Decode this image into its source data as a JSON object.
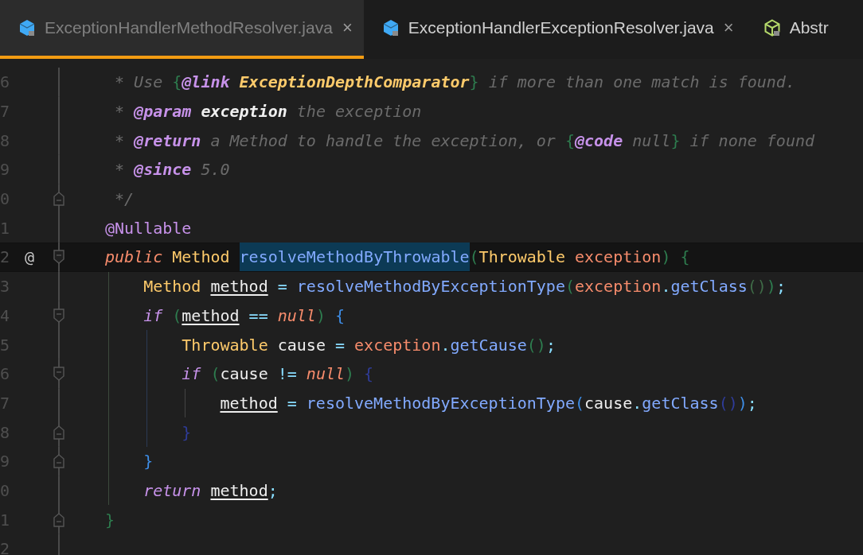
{
  "tabs": [
    {
      "label": "ExceptionHandlerMethodResolver.java",
      "close": "×",
      "selected": true
    },
    {
      "label": "ExceptionHandlerExceptionResolver.java",
      "close": "×",
      "selected": false
    },
    {
      "label": "Abstr",
      "selected": false
    }
  ],
  "editor": {
    "lines": [
      {
        "number": "6",
        "tokens": [
          {
            "kind": "comment",
            "text": "* Use"
          },
          {
            "kind": "bracket",
            "text": "{",
            "color": "#2e7d4f",
            "space_before": true
          },
          {
            "kind": "tag",
            "text": "@link"
          },
          {
            "kind": "ref",
            "text": "ExceptionDepthComparator",
            "space_before": true
          },
          {
            "kind": "bracket",
            "text": "}",
            "color": "#2e7d4f"
          },
          {
            "kind": "comment",
            "text": "if more than one match is found.",
            "space_before": true
          }
        ]
      },
      {
        "number": "7",
        "tokens": [
          {
            "kind": "comment",
            "text": "*"
          },
          {
            "kind": "tag",
            "text": "@param",
            "space_before": true
          },
          {
            "kind": "docparam",
            "text": "exception",
            "space_before": true
          },
          {
            "kind": "comment",
            "text": "the exception",
            "space_before": true
          }
        ]
      },
      {
        "number": "8",
        "tokens": [
          {
            "kind": "comment",
            "text": "*"
          },
          {
            "kind": "tag",
            "text": "@return",
            "space_before": true
          },
          {
            "kind": "comment",
            "text": "a Method to handle the exception, or",
            "space_before": true
          },
          {
            "kind": "bracket",
            "text": "{",
            "color": "#2e7d4f",
            "space_before": true
          },
          {
            "kind": "tag",
            "text": "@code"
          },
          {
            "kind": "comment",
            "text": "null",
            "space_before": true
          },
          {
            "kind": "bracket",
            "text": "}",
            "color": "#2e7d4f"
          },
          {
            "kind": "comment",
            "text": "if none found",
            "space_before": true
          }
        ]
      },
      {
        "number": "9",
        "tokens": [
          {
            "kind": "comment",
            "text": "*"
          },
          {
            "kind": "tag",
            "text": "@since",
            "space_before": true
          },
          {
            "kind": "comment",
            "text": "5.0",
            "space_before": true
          }
        ]
      },
      {
        "number": "0",
        "fold_end": true,
        "tokens": [
          {
            "kind": "comment",
            "text": "*/"
          }
        ]
      },
      {
        "number": "1",
        "tokens": [
          {
            "kind": "annotation",
            "text": "@Nullable"
          }
        ]
      },
      {
        "number": "2",
        "current": true,
        "marker": "@",
        "fold_start": true,
        "tokens": [
          {
            "kind": "modifier",
            "text": "public"
          },
          {
            "kind": "type",
            "text": "Method",
            "space_before": true
          },
          {
            "kind": "method",
            "text": "resolveMethodByThrowable",
            "highlighted": true,
            "space_before": true
          },
          {
            "kind": "bracket",
            "text": "(",
            "color": "#2e7d4f"
          },
          {
            "kind": "type",
            "text": "Throwable"
          },
          {
            "kind": "param",
            "text": "exception",
            "space_before": true
          },
          {
            "kind": "bracket",
            "text": ")",
            "color": "#2e7d4f"
          },
          {
            "kind": "bracket",
            "text": "{",
            "color": "#2e7d4f",
            "space_before": true
          }
        ],
        "children": [
          {
            "number": "3",
            "tokens": [
              {
                "kind": "type",
                "text": "Method"
              },
              {
                "kind": "reassigned",
                "text": "method",
                "space_before": true
              },
              {
                "kind": "plain",
                "text": "=",
                "space_before": true
              },
              {
                "kind": "method",
                "text": "resolveMethodByExceptionType",
                "space_before": true
              },
              {
                "kind": "bracket",
                "text": "(",
                "color": "#2e7d4f"
              },
              {
                "kind": "param",
                "text": "exception"
              },
              {
                "kind": "plain",
                "text": "."
              },
              {
                "kind": "method",
                "text": "getClass"
              },
              {
                "kind": "bracket",
                "text": "()",
                "color": "#3f6b47"
              },
              {
                "kind": "bracket",
                "text": ")",
                "color": "#2e7d4f"
              },
              {
                "kind": "plain",
                "text": ";"
              }
            ]
          },
          {
            "number": "4",
            "fold_start": true,
            "tokens": [
              {
                "kind": "control",
                "text": "if"
              },
              {
                "kind": "bracket",
                "text": "(",
                "color": "#2e7d4f",
                "space_before": true
              },
              {
                "kind": "reassigned",
                "text": "method"
              },
              {
                "kind": "plain",
                "text": "==",
                "space_before": true
              },
              {
                "kind": "literal",
                "text": "null",
                "space_before": true
              },
              {
                "kind": "bracket",
                "text": ")",
                "color": "#2e7d4f"
              },
              {
                "kind": "bracket",
                "text": "{",
                "color": "#3e8ee8",
                "space_before": true
              }
            ],
            "children": [
              {
                "number": "5",
                "tokens": [
                  {
                    "kind": "type",
                    "text": "Throwable"
                  },
                  {
                    "kind": "var",
                    "text": "cause",
                    "space_before": true
                  },
                  {
                    "kind": "plain",
                    "text": "=",
                    "space_before": true
                  },
                  {
                    "kind": "param",
                    "text": "exception",
                    "space_before": true
                  },
                  {
                    "kind": "plain",
                    "text": "."
                  },
                  {
                    "kind": "method",
                    "text": "getCause"
                  },
                  {
                    "kind": "bracket",
                    "text": "()",
                    "color": "#2e7d4f"
                  },
                  {
                    "kind": "plain",
                    "text": ";"
                  }
                ]
              },
              {
                "number": "6",
                "fold_start": true,
                "tokens": [
                  {
                    "kind": "control",
                    "text": "if"
                  },
                  {
                    "kind": "bracket",
                    "text": "(",
                    "color": "#2e7d4f",
                    "space_before": true
                  },
                  {
                    "kind": "var",
                    "text": "cause"
                  },
                  {
                    "kind": "plain",
                    "text": "!=",
                    "space_before": true
                  },
                  {
                    "kind": "literal",
                    "text": "null",
                    "space_before": true
                  },
                  {
                    "kind": "bracket",
                    "text": ")",
                    "color": "#2e7d4f"
                  },
                  {
                    "kind": "bracket",
                    "text": "{",
                    "color": "#2f3c9a",
                    "space_before": true
                  }
                ],
                "children": [
                  {
                    "number": "7",
                    "tokens": [
                      {
                        "kind": "reassigned",
                        "text": "method"
                      },
                      {
                        "kind": "plain",
                        "text": "=",
                        "space_before": true
                      },
                      {
                        "kind": "method",
                        "text": "resolveMethodByExceptionType",
                        "space_before": true
                      },
                      {
                        "kind": "bracket",
                        "text": "(",
                        "color": "#3e8ee8"
                      },
                      {
                        "kind": "var",
                        "text": "cause"
                      },
                      {
                        "kind": "plain",
                        "text": "."
                      },
                      {
                        "kind": "method",
                        "text": "getClass"
                      },
                      {
                        "kind": "bracket",
                        "text": "()",
                        "color": "#2f3c9a"
                      },
                      {
                        "kind": "bracket",
                        "text": ")",
                        "color": "#3e8ee8"
                      },
                      {
                        "kind": "plain",
                        "text": ";"
                      }
                    ]
                  }
                ]
              },
              {
                "number": "8",
                "fold_end": true,
                "tokens": [
                  {
                    "kind": "bracket",
                    "text": "}",
                    "color": "#2f3c9a"
                  }
                ]
              }
            ]
          },
          {
            "number": "9",
            "fold_end": true,
            "tokens": [
              {
                "kind": "bracket",
                "text": "}",
                "color": "#3e8ee8"
              }
            ]
          },
          {
            "number": "0",
            "tokens": [
              {
                "kind": "control",
                "text": "return"
              },
              {
                "kind": "reassigned",
                "text": "method",
                "space_before": true
              },
              {
                "kind": "plain",
                "text": ";"
              }
            ]
          }
        ]
      },
      {
        "number": "1",
        "fold_end": true,
        "tokens": [
          {
            "kind": "bracket",
            "text": "}",
            "color": "#2e7d4f"
          }
        ]
      },
      {
        "number": "2"
      }
    ]
  }
}
